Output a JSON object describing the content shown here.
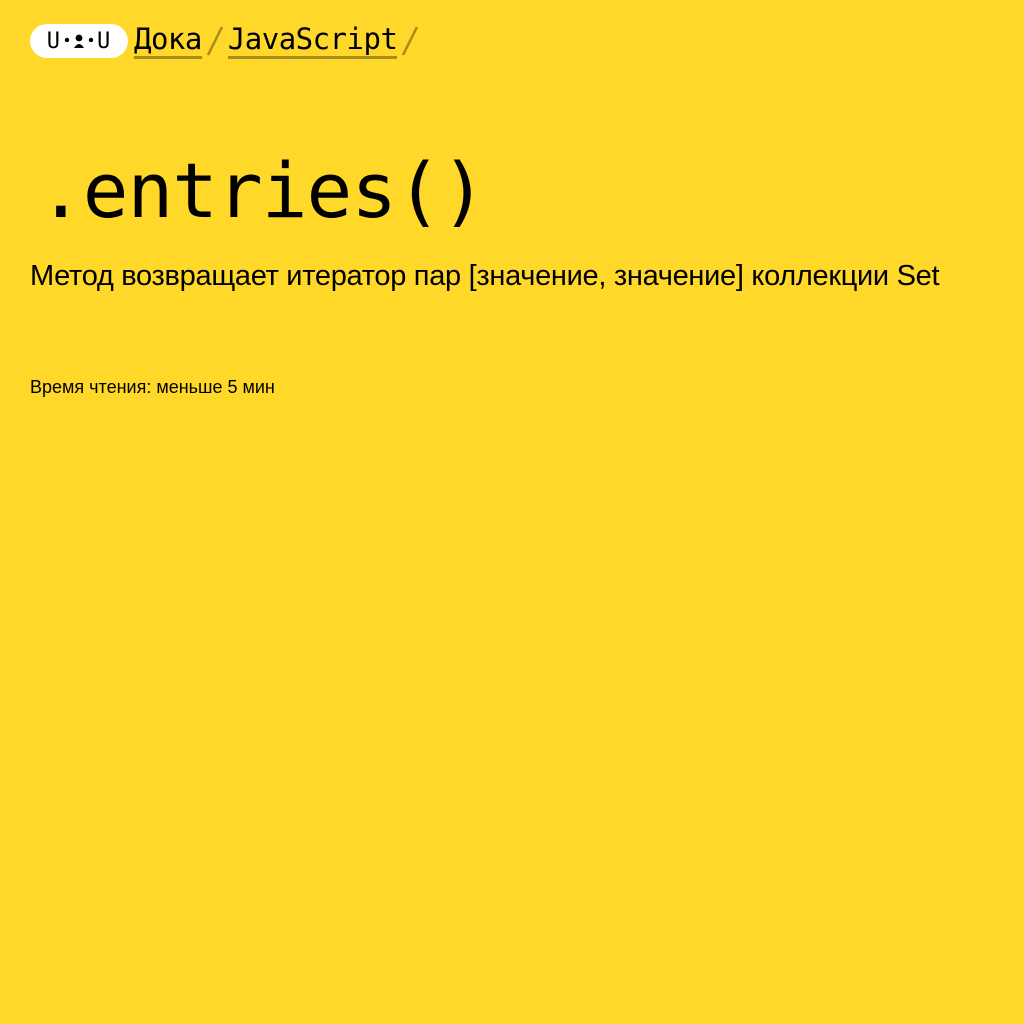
{
  "colors": {
    "background": "#FFD829",
    "text": "#000000",
    "logo_background": "#FFFFFF"
  },
  "header": {
    "logo": {
      "left_letter": "U",
      "right_letter": "U",
      "icon": "doka-face-logo"
    },
    "breadcrumbs": [
      {
        "label": "Дока"
      },
      {
        "label": "JavaScript"
      }
    ],
    "separator_icon": "slash-separator-icon"
  },
  "article": {
    "title": ".entries()",
    "description": "Метод возвращает итератор пар [значение, значение] коллекции Set",
    "reading_time": "Время чтения: меньше 5 мин"
  }
}
